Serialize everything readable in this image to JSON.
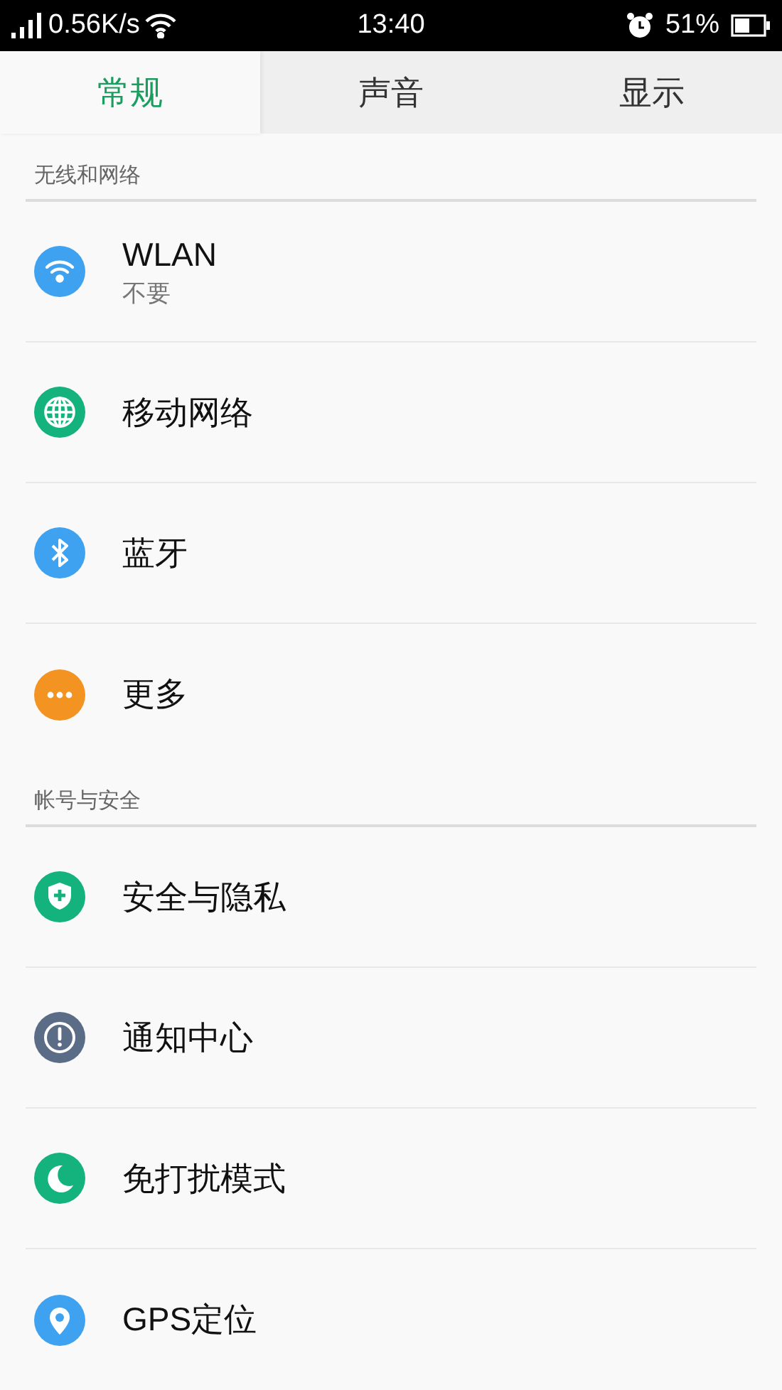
{
  "status_bar": {
    "speed": "0.56K/s",
    "time": "13:40",
    "battery": "51%"
  },
  "tabs": [
    {
      "label": "常规",
      "selected": true
    },
    {
      "label": "声音",
      "selected": false
    },
    {
      "label": "显示",
      "selected": false
    }
  ],
  "sections": [
    {
      "title": "无线和网络",
      "items": [
        {
          "kind": "wifi",
          "color": "#3fa2f0",
          "label": "WLAN",
          "subtitle": "不要"
        },
        {
          "kind": "globe",
          "color": "#14b37d",
          "label": "移动网络"
        },
        {
          "kind": "bluetooth",
          "color": "#3fa2f0",
          "label": "蓝牙"
        },
        {
          "kind": "more",
          "color": "#f39322",
          "label": "更多"
        }
      ]
    },
    {
      "title": "帐号与安全",
      "items": [
        {
          "kind": "shield",
          "color": "#14b37d",
          "label": "安全与隐私"
        },
        {
          "kind": "alert",
          "color": "#5a6c86",
          "label": "通知中心"
        },
        {
          "kind": "moon",
          "color": "#14b37d",
          "label": "免打扰模式"
        },
        {
          "kind": "pin",
          "color": "#3fa2f0",
          "label": "GPS定位"
        }
      ]
    }
  ]
}
